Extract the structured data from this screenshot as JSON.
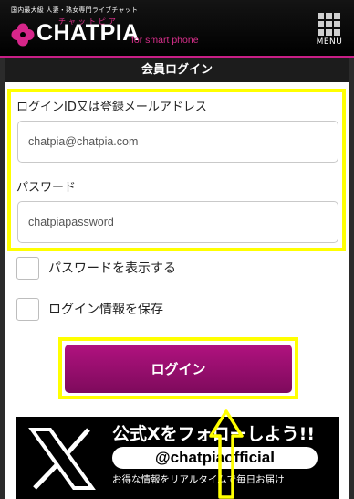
{
  "header": {
    "tagline": "国内最大級 人妻・熟女専門ライブチャット",
    "logo_ruby": "チャットピア",
    "logo_text": "CHATPIA",
    "logo_sub": "for smart phone",
    "menu_label": "MENU",
    "accent_color": "#c71e86"
  },
  "page": {
    "title": "会員ログイン"
  },
  "form": {
    "id_label": "ログインID又は登録メールアドレス",
    "id_value": "chatpia@chatpia.com",
    "password_label": "パスワード",
    "password_value": "chatpiapassword",
    "show_password_label": "パスワードを表示する",
    "save_login_label": "ログイン情報を保存",
    "login_button_label": "ログイン",
    "button_color": "#9c0f72"
  },
  "banner": {
    "title": "公式Xをフォローしよう!!",
    "handle": "@chatpiaofficial",
    "description": "お得な情報をリアルタイムで毎日お届け"
  },
  "annotations": {
    "highlight_color": "#ffff00"
  }
}
